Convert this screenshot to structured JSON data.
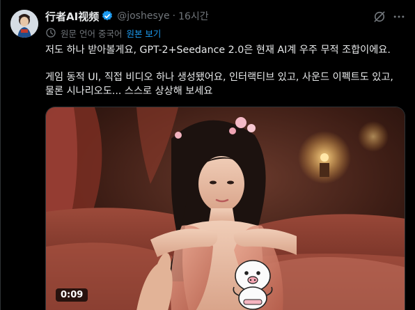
{
  "author": {
    "name": "行者AI视频",
    "handle": "@joshesye",
    "separator": "·",
    "time": "16시간"
  },
  "translation": {
    "label": "원문 언어 중국어",
    "link": "원본 보기"
  },
  "post": {
    "line1": "저도 하나 받아볼게요, GPT-2+Seedance 2.0은 현재 AI계 우주 무적 조합이에요.",
    "line2": "게임 동적 UI, 직접 비디오 하나 생성됐어요, 인터랙티브 있고, 사운드 이펙트도 있고,",
    "line3": "물론 시나리오도... 스스로 상상해 보세요"
  },
  "video": {
    "duration": "0:09"
  },
  "icons": {
    "verified": "verified-badge-icon",
    "grok": "grok-icon",
    "more": "more-icon",
    "translate": "translate-icon"
  },
  "colors": {
    "background": "#000000",
    "text": "#e7e9ea",
    "muted": "#71767b",
    "accent": "#1d9bf0"
  }
}
